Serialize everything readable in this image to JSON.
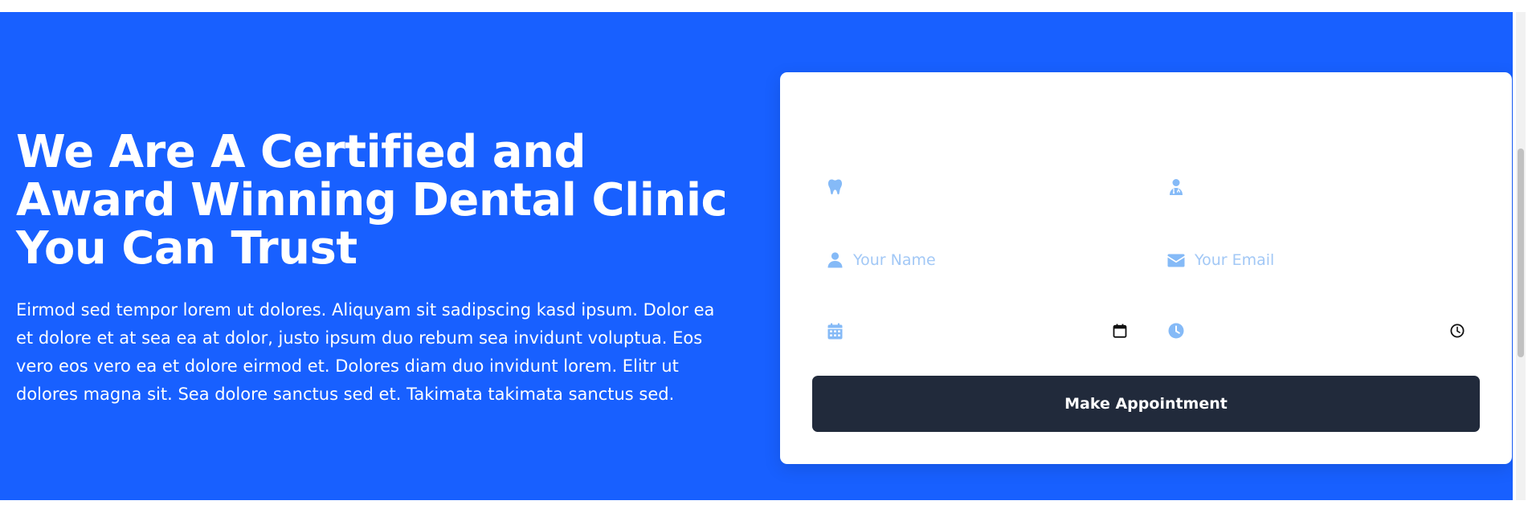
{
  "hero": {
    "title": "We Are A Certified and Award Winning Dental Clinic You Can Trust",
    "description": "Eirmod sed tempor lorem ut dolores. Aliquyam sit sadipscing kasd ipsum. Dolor ea et dolore et at sea ea at dolor, justo ipsum duo rebum sea invidunt voluptua. Eos vero eos vero ea et dolore eirmod et. Dolores diam duo invidunt lorem. Elitr ut dolores magna sit. Sea dolore sanctus sed et. Takimata takimata sanctus sed."
  },
  "form": {
    "service": {
      "icon": "tooth-icon",
      "value": ""
    },
    "doctor": {
      "icon": "user-doctor-icon",
      "value": ""
    },
    "name": {
      "icon": "user-icon",
      "placeholder": "Your Name",
      "value": ""
    },
    "email": {
      "icon": "envelope-icon",
      "placeholder": "Your Email",
      "value": ""
    },
    "date": {
      "icon": "calendar-icon",
      "picker_icon": "calendar-picker-icon",
      "value": ""
    },
    "time": {
      "icon": "clock-icon",
      "picker_icon": "clock-picker-icon",
      "value": ""
    },
    "submit_label": "Make Appointment"
  },
  "colors": {
    "hero_background": "#1860ff",
    "card_background": "#ffffff",
    "icon_accent": "#85baf7",
    "placeholder": "#a2c8f6",
    "button_background": "#212a3b",
    "button_text": "#ffffff"
  }
}
